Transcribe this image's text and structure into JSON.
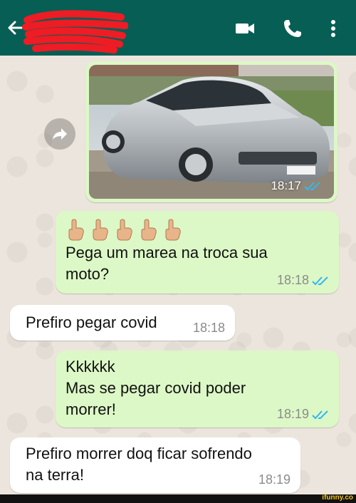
{
  "header": {
    "contact_name": "",
    "back_icon": "arrow-left-icon",
    "video_icon": "video-call-icon",
    "call_icon": "phone-icon",
    "menu_icon": "more-vert-icon"
  },
  "colors": {
    "header_bg": "#075e54",
    "outgoing_bubble": "#dcf8c6",
    "incoming_bubble": "#ffffff",
    "read_ticks": "#34b7f1"
  },
  "messages": [
    {
      "direction": "out",
      "type": "image",
      "image_desc": "car-photo",
      "time": "18:17",
      "status": "read"
    },
    {
      "direction": "out",
      "type": "text",
      "emoji": [
        "👆🏼",
        "👆🏼",
        "👆🏼",
        "👆🏼",
        "👆🏼"
      ],
      "lines": [
        "Pega um marea na troca sua",
        "moto?"
      ],
      "time": "18:18",
      "status": "read"
    },
    {
      "direction": "in",
      "type": "text",
      "lines": [
        "Prefiro pegar covid"
      ],
      "time": "18:18"
    },
    {
      "direction": "out",
      "type": "text",
      "lines": [
        "Kkkkkk",
        "Mas se pegar covid poder",
        "morrer!"
      ],
      "time": "18:19",
      "status": "read"
    },
    {
      "direction": "in",
      "type": "text",
      "lines": [
        "Prefiro morrer doq ficar sofrendo",
        "na terra!"
      ],
      "time": "18:19"
    }
  ],
  "photo": {
    "plate_text": "",
    "banner_text": ""
  },
  "watermark": "ifunny.co"
}
